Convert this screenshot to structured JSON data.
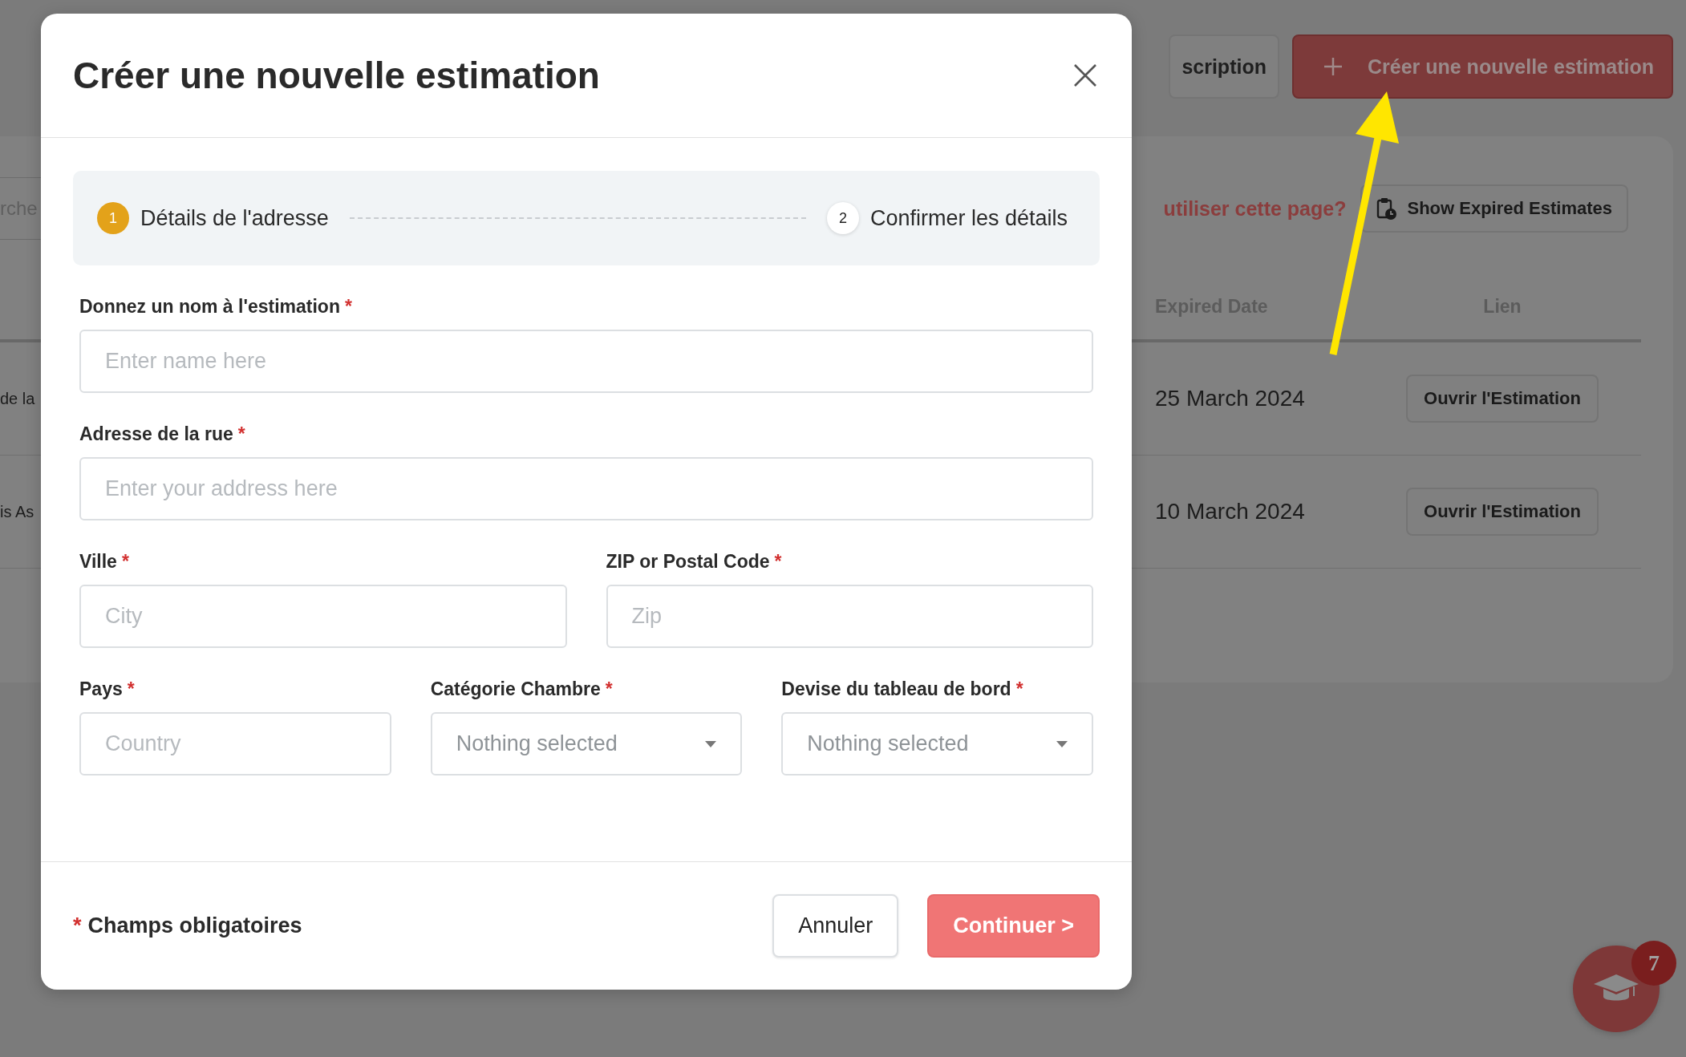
{
  "background": {
    "header_buttons": [
      {
        "kind": "secondary",
        "label": "scription"
      },
      {
        "kind": "primary",
        "label": "Créer une nouvelle estimation"
      }
    ],
    "search": {
      "placeholder": "rche"
    },
    "help_link": "utiliser cette page?",
    "expired_button": "Show Expired Estimates",
    "table": {
      "columns": [
        "Expired Date",
        "Lien"
      ],
      "rows": [
        {
          "column_1": "de la",
          "expired_date": "25 March 2024",
          "link": "Ouvrir l'Estimation"
        },
        {
          "column_1": "is As",
          "expired_date": "10 March 2024",
          "link": "Ouvrir l'Estimation"
        }
      ]
    },
    "help_widget": {
      "badge": "7"
    }
  },
  "modal": {
    "title": "Créer une nouvelle estimation",
    "steps": [
      {
        "number": "1",
        "label": "Détails de l'adresse",
        "selected": true
      },
      {
        "number": "2",
        "label": "Confirmer les détails",
        "selected": false
      }
    ],
    "rows": [
      [
        {
          "kind": "text",
          "label": "Donnez un nom à l'estimation",
          "required_mark": "*",
          "placeholder": "Enter name here"
        }
      ],
      [
        {
          "kind": "text",
          "label": "Adresse de la rue",
          "required_mark": "*",
          "placeholder": "Enter your address here"
        }
      ],
      [
        {
          "kind": "text",
          "label": "Ville",
          "required_mark": "*",
          "placeholder": "City"
        },
        {
          "kind": "text",
          "label": "ZIP or Postal Code",
          "required_mark": "*",
          "placeholder": "Zip"
        }
      ],
      [
        {
          "kind": "text",
          "label": "Pays",
          "required_mark": "*",
          "placeholder": "Country"
        },
        {
          "kind": "select",
          "label": "Catégorie Chambre",
          "required_mark": "*",
          "value": "Nothing selected"
        },
        {
          "kind": "select",
          "label": "Devise du tableau de bord",
          "required_mark": "*",
          "value": "Nothing selected"
        }
      ]
    ],
    "required_note": {
      "mark": "*",
      "text": "Champs obligatoires"
    },
    "cancel_button": "Annuler",
    "continue_button": "Continuer >"
  }
}
